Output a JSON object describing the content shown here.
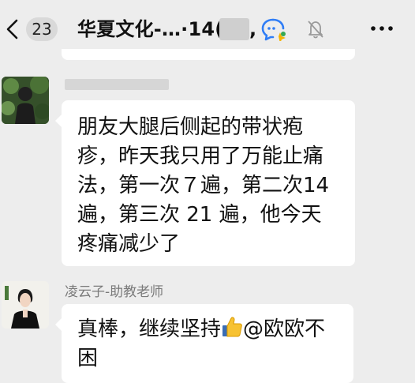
{
  "header": {
    "back_icon": "chevron-left-icon",
    "unread_count": "23",
    "title": "华夏文化-…·14(",
    "title_suffix": ",",
    "icons": [
      "chat-search-icon",
      "bell-muted-icon",
      "more-icon"
    ]
  },
  "messages": [
    {
      "lines": [
        "朋友大腿后侧起的带状疱",
        "疹，昨天我只用了万能止痛",
        "法，第一次７遍，第二次14",
        "遍，第三次 21 遍，他今天",
        "疼痛减少了"
      ]
    },
    {
      "sender": "凌云子-助教老师",
      "line1_before": "真棒，继续坚持",
      "line1_after": "@欧欧不",
      "line2": "困"
    }
  ],
  "colors": {
    "background": "#ededed",
    "bubble": "#ffffff",
    "accent_blue": "#2f7df6"
  }
}
